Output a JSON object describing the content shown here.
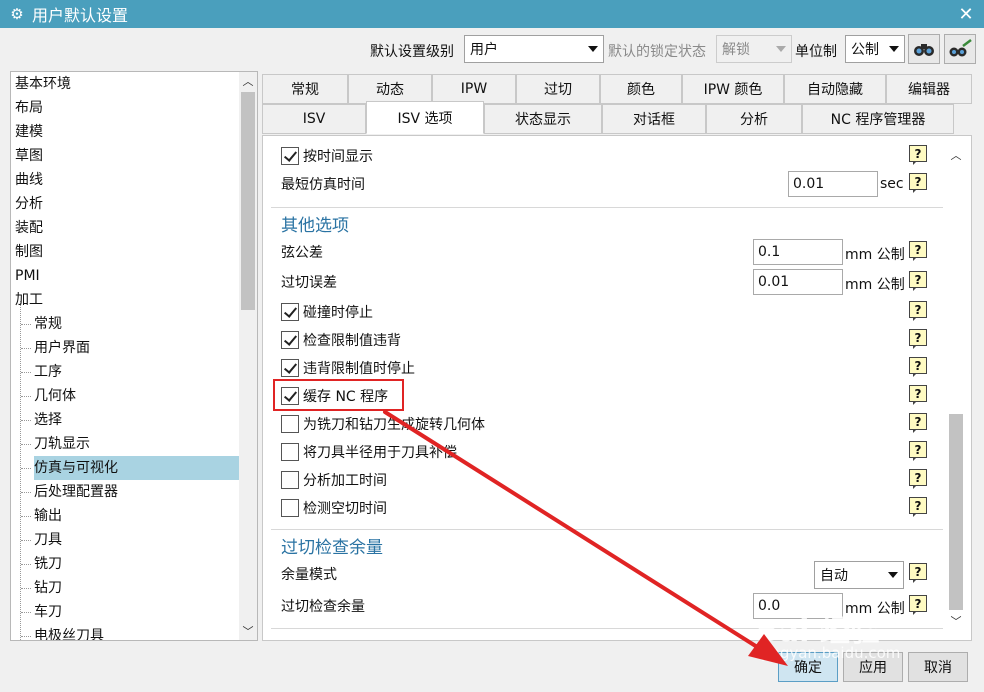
{
  "window": {
    "title": "用户默认设置",
    "gear_icon": "gear-icon",
    "close_glyph": "✕"
  },
  "toolbar": {
    "level_label": "默认设置级别",
    "level_value": "用户",
    "lock_state_label": "默认的锁定状态",
    "lock_state_value": "解锁",
    "unit_label": "单位制",
    "unit_value": "公制"
  },
  "tree": {
    "items": [
      "基本环境",
      "布局",
      "建模",
      "草图",
      "曲线",
      "分析",
      "装配",
      "制图",
      "PMI",
      "加工",
      "常规",
      "用户界面",
      "工序",
      "几何体",
      "选择",
      "刀轨显示",
      "仿真与可视化",
      "后处理配置器",
      "输出",
      "刀具",
      "铣刀",
      "钻刀",
      "车刀",
      "电极丝刀具"
    ],
    "selected": "仿真与可视化"
  },
  "tabs": {
    "row1": [
      "常规",
      "动态",
      "IPW",
      "过切",
      "颜色",
      "IPW 颜色",
      "自动隐藏",
      "编辑器"
    ],
    "row2": [
      "ISV",
      "ISV 选项",
      "状态显示",
      "对话框",
      "分析",
      "NC 程序管理器"
    ],
    "active": "ISV 选项"
  },
  "panel": {
    "show_by_time": {
      "label": "按时间显示",
      "checked": true
    },
    "min_sim_time": {
      "label": "最短仿真时间",
      "value": "0.01",
      "unit": "sec"
    },
    "other_options_title": "其他选项",
    "chord_tol": {
      "label": "弦公差",
      "value": "0.1",
      "unit": "mm 公制"
    },
    "gouge_tol": {
      "label": "过切误差",
      "value": "0.01",
      "unit": "mm 公制"
    },
    "checkboxes": [
      {
        "label": "碰撞时停止",
        "checked": true
      },
      {
        "label": "检查限制值违背",
        "checked": true
      },
      {
        "label": "违背限制值时停止",
        "checked": true
      },
      {
        "label": "缓存 NC 程序",
        "checked": true
      },
      {
        "label": "为铣刀和钻刀生成旋转几何体",
        "checked": false
      },
      {
        "label": "将刀具半径用于刀具补偿",
        "checked": false
      },
      {
        "label": "分析加工时间",
        "checked": false
      },
      {
        "label": "检测空切时间",
        "checked": false
      }
    ],
    "gouge_check_title": "过切检查余量",
    "stock_mode": {
      "label": "余量模式",
      "value": "自动"
    },
    "gouge_check_stock": {
      "label": "过切检查余量",
      "value": "0.0",
      "unit": "mm 公制"
    },
    "help_glyph": "?"
  },
  "buttons": {
    "ok": "确定",
    "apply": "应用",
    "cancel": "取消"
  },
  "watermark": {
    "logo": "Bai 经验",
    "url": "jingyan.baidu.com"
  },
  "colors": {
    "titlebar": "#4a9fbd",
    "section": "#2a73a3",
    "highlight": "#e02424",
    "selected": "#a9d3e2"
  }
}
